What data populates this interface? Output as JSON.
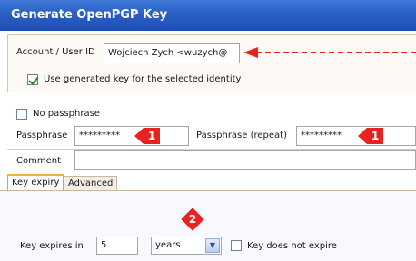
{
  "window": {
    "title": "Generate OpenPGP Key"
  },
  "account": {
    "label": "Account / User ID",
    "value": "Wojciech Zych <wuzych@",
    "use_generated_label": "Use generated key for the selected identity",
    "use_generated_checked": true
  },
  "passphrase": {
    "no_passphrase_label": "No passphrase",
    "no_passphrase_checked": false,
    "label": "Passphrase",
    "value": "*********",
    "repeat_label": "Passphrase (repeat)",
    "repeat_value": "*********"
  },
  "comment": {
    "label": "Comment",
    "value": ""
  },
  "tabs": [
    {
      "label": "Key expiry",
      "active": true
    },
    {
      "label": "Advanced",
      "active": false
    }
  ],
  "expiry": {
    "label": "Key expires in",
    "value": "5",
    "unit": "years",
    "does_not_expire_label": "Key does not expire",
    "does_not_expire_checked": false
  },
  "annotations": {
    "badge_1": "1",
    "badge_2": "2",
    "accent": "#e8231f"
  }
}
